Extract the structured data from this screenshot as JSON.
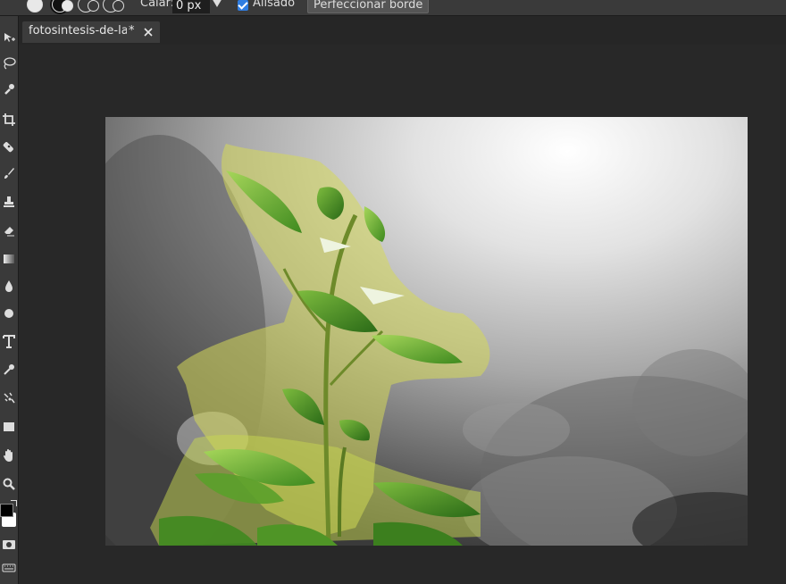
{
  "options_bar": {
    "feather_label": "Calar:",
    "feather_value": "0 px",
    "antialias_label": "Alisado",
    "antialias_checked": true,
    "refine_edge_label": "Perfeccionar borde"
  },
  "document_tab": {
    "title": "fotosintesis-de-la",
    "modified_marker": "*"
  },
  "toolbar": {
    "tools": [
      "move-tool-icon",
      "lasso-tool-icon",
      "quick-selection-icon",
      "crop-tool-icon",
      "healing-brush-icon",
      "brush-tool-icon",
      "clone-stamp-icon",
      "eraser-icon",
      "gradient-icon",
      "blur-drop-icon",
      "sponge-icon",
      "type-tool-icon",
      "eyedropper-icon",
      "color-replace-icon",
      "rectangle-icon",
      "hand-tool-icon",
      "zoom-tool-icon"
    ]
  },
  "colors": {
    "foreground": "#000000",
    "background": "#ffffff",
    "accent": "#2f7de1"
  }
}
